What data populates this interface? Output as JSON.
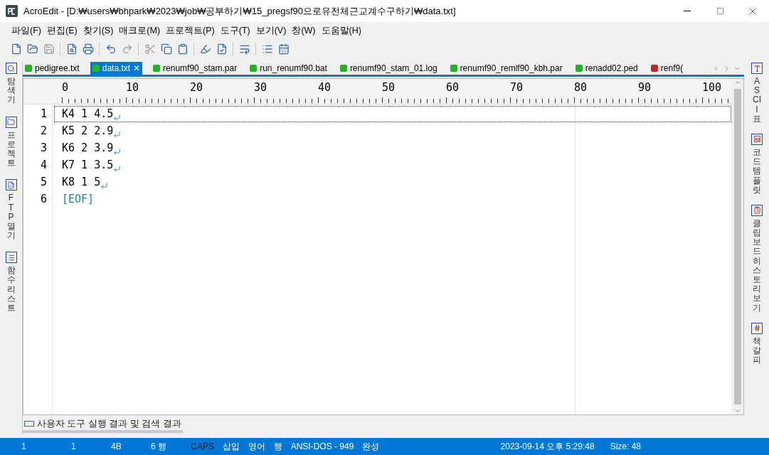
{
  "window": {
    "title": "AcroEdit - [D:₩users₩bhpark₩2023₩job₩공부하기₩15_pregsf90으로유전체근교계수구하기₩data.txt]"
  },
  "menu": [
    "파일(F)",
    "편집(E)",
    "찾기(S)",
    "매크로(M)",
    "프로젝트(P)",
    "도구(T)",
    "보기(V)",
    "창(W)",
    "도움말(H)"
  ],
  "toolbar": [
    {
      "kind": "new",
      "disabled": false
    },
    {
      "kind": "open",
      "disabled": false
    },
    {
      "kind": "save",
      "disabled": true
    },
    {
      "kind": "preview",
      "disabled": false
    },
    {
      "kind": "print",
      "disabled": false
    },
    {
      "kind": "undo",
      "disabled": false
    },
    {
      "kind": "redo",
      "disabled": true
    },
    {
      "kind": "cut",
      "disabled": true
    },
    {
      "kind": "copy",
      "disabled": false
    },
    {
      "kind": "paste",
      "disabled": false
    },
    {
      "kind": "marker",
      "disabled": false
    },
    {
      "kind": "check",
      "disabled": false
    },
    {
      "kind": "wrap",
      "disabled": false
    },
    {
      "kind": "list",
      "disabled": false
    },
    {
      "kind": "calendar",
      "disabled": false
    }
  ],
  "tabs": [
    {
      "label": "pedigree.txt",
      "color": "#22b322",
      "selected": false
    },
    {
      "label": "data.txt",
      "color": "#22b322",
      "selected": true,
      "close": "✕"
    },
    {
      "label": "renumf90_stam.par",
      "color": "#22b322",
      "selected": false
    },
    {
      "label": "run_renumf90.bat",
      "color": "#22b322",
      "selected": false
    },
    {
      "label": "renumf90_stam_01.log",
      "color": "#22b322",
      "selected": false
    },
    {
      "label": "renumf90_remlf90_kbh.par",
      "color": "#22b322",
      "selected": false
    },
    {
      "label": "renadd02.ped",
      "color": "#22b322",
      "selected": false
    },
    {
      "label": "renf9(",
      "color": "#c02828",
      "selected": false
    }
  ],
  "left_panel": [
    "탐색기",
    "프로젝트",
    "FTP 열기",
    "함수 리스트"
  ],
  "right_panel": [
    "ASCII 표",
    "코드 템플릿",
    "클립보드 히스토리 보기",
    "책갈피"
  ],
  "ruler": [
    "0",
    "10",
    "20",
    "30",
    "40",
    "50",
    "60",
    "70",
    "80",
    "90",
    "100"
  ],
  "lines": [
    {
      "number": "1",
      "text": "K4 1 4.5",
      "kind": "text",
      "current": true
    },
    {
      "number": "2",
      "text": "K5 2 2.9",
      "kind": "text",
      "current": false
    },
    {
      "number": "3",
      "text": "K6 2 3.9",
      "kind": "text",
      "current": false
    },
    {
      "number": "4",
      "text": "K7 1 3.5",
      "kind": "text",
      "current": false
    },
    {
      "number": "5",
      "text": "K8 1 5",
      "kind": "text",
      "current": false
    },
    {
      "number": "6",
      "text": "[EOF]",
      "kind": "eof",
      "current": false
    }
  ],
  "output_tab": {
    "label": "사용자 도구 실행 결과 및 검색 결과"
  },
  "status_bar": {
    "left": [
      {
        "text": "1",
        "active": false
      },
      {
        "text": "1",
        "active": false
      },
      {
        "text": "4B",
        "active": false
      },
      {
        "text": "6 행",
        "active": false
      },
      {
        "text": "CAPS",
        "active": true
      },
      {
        "text": "삽입",
        "active": false
      },
      {
        "text": "영어",
        "active": false
      },
      {
        "text": "행",
        "active": false
      },
      {
        "text": "ANSI-DOS - 949",
        "active": false
      },
      {
        "text": "완성",
        "active": false
      }
    ],
    "right": [
      "2023-09-14 오후 5:29:48",
      "Size: 48"
    ]
  }
}
